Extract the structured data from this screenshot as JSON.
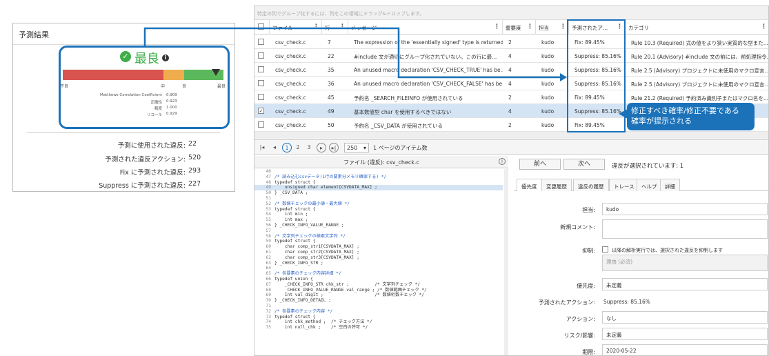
{
  "result_panel": {
    "title": "予測結果",
    "rating": "最良",
    "bar_labels": {
      "bad": "不良",
      "mid": "中",
      "good": "良",
      "best": "最良"
    },
    "metrics": [
      {
        "label": "Matthews Correlation Coefficient",
        "value": "0.909"
      },
      {
        "label": "正確性",
        "value": "0.923"
      },
      {
        "label": "精度",
        "value": "1.000"
      },
      {
        "label": "リコール",
        "value": "0.929"
      }
    ],
    "stats": [
      {
        "label": "予測に使用された違反:",
        "value": "22"
      },
      {
        "label": "予測された違反アクション:",
        "value": "520"
      },
      {
        "label": "Fix に予測された違反:",
        "value": "293"
      },
      {
        "label": "Suppress に予測された違反:",
        "value": "227"
      }
    ]
  },
  "grid": {
    "group_hint": "特定の列でグループ化するには、列をこの領域にドラッグ&ドロップします。",
    "columns": [
      "ファイル",
      "行",
      "メッセージ",
      "重要度",
      "担当",
      "予測されたア...",
      "カテゴリ"
    ],
    "rows": [
      {
        "file": "csv_check.c",
        "line": "7",
        "msg": "The expression of the 'essentially signed' type is returned fro...",
        "sev": "2",
        "owner": "kudo",
        "pred": "Fix: 89.45%",
        "cat": "Rule 10.3 (Required) 式の値をより狭い実質的な型また...",
        "checked": false
      },
      {
        "file": "csv_check.c",
        "line": "22",
        "msg": "#include 文が適切にグループ化されていない。この行に最...",
        "sev": "4",
        "owner": "kudo",
        "pred": "Suppress: 85.16%",
        "cat": "Rule 20.1 (Advisory) #include 文の前には、前処理指令...",
        "checked": false
      },
      {
        "file": "csv_check.c",
        "line": "35",
        "msg": "An unused macro declaration 'CSV_CHECK_TRUE' has be...",
        "sev": "4",
        "owner": "kudo",
        "pred": "Suppress: 85.16%",
        "cat": "Rule 2.5 (Advisory) プロジェクトに未使用のマクロ宣言...",
        "checked": false
      },
      {
        "file": "csv_check.c",
        "line": "36",
        "msg": "An unused macro declaration 'CSV_CHECK_FALSE' has be...",
        "sev": "4",
        "owner": "kudo",
        "pred": "Suppress: 85.16%",
        "cat": "Rule 2.5 (Advisory) プロジェクトに未使用のマクロ宣言...",
        "checked": false
      },
      {
        "file": "csv_check.c",
        "line": "45",
        "msg": "予約名 _SEARCH_FILEINFO が使用されている",
        "sev": "2",
        "owner": "kudo",
        "pred": "Fix: 89.45%",
        "cat": "Rule 21.2 (Required) 予約済み識別子またはマクロ名を...",
        "checked": false
      },
      {
        "file": "csv_check.c",
        "line": "49",
        "msg": "基本数値型 char を使用するべきではない",
        "sev": "4",
        "owner": "kudo",
        "pred": "Suppress: 85.16%",
        "cat": "",
        "checked": true
      },
      {
        "file": "csv_check.c",
        "line": "50",
        "msg": "予約名 _CSV_DATA が使用されている",
        "sev": "2",
        "owner": "kudo",
        "pred": "Fix: 89.45%",
        "cat": "",
        "checked": false
      }
    ]
  },
  "pager": {
    "pages": [
      "1",
      "2",
      "3"
    ],
    "page_size": "250",
    "page_size_label": "1 ページのアイテム数"
  },
  "code": {
    "title": "ファイル (違反): csv_check.c",
    "lines": [
      {
        "n": "46",
        "t": ""
      },
      {
        "n": "47",
        "t": "/* 読み込むcsvデータ(1行の要素分メモリ確保する) */"
      },
      {
        "n": "48",
        "t": "typedef struct {"
      },
      {
        "n": "49",
        "t": "    unsigned char element[CSVDATA_MAX] ;"
      },
      {
        "n": "50",
        "t": "} _CSV_DATA ;"
      },
      {
        "n": "51",
        "t": ""
      },
      {
        "n": "52",
        "t": "/* 数値チェックの最小値・最大値 */"
      },
      {
        "n": "53",
        "t": "typedef struct {"
      },
      {
        "n": "54",
        "t": "    int min ;"
      },
      {
        "n": "55",
        "t": "    int max ;"
      },
      {
        "n": "56",
        "t": "} _CHECK_INFO_VALUE_RANGE ;"
      },
      {
        "n": "57",
        "t": ""
      },
      {
        "n": "58",
        "t": "/* 文字列チェックの検索文字列 */"
      },
      {
        "n": "59",
        "t": "typedef struct {"
      },
      {
        "n": "60",
        "t": "    char comp_str1[CSVDATA_MAX] ;"
      },
      {
        "n": "61",
        "t": "    char comp_str2[CSVDATA_MAX] ;"
      },
      {
        "n": "62",
        "t": "    char comp_str3[CSVDATA_MAX] ;"
      },
      {
        "n": "63",
        "t": "} _CHECK_INFO_STR ;"
      },
      {
        "n": "64",
        "t": ""
      },
      {
        "n": "65",
        "t": "/* 各要素のチェック内容詳細 */"
      },
      {
        "n": "66",
        "t": "typedef union {"
      },
      {
        "n": "67",
        "t": "    _CHECK_INFO_STR chk_str ;          /* 文字列チェック */"
      },
      {
        "n": "68",
        "t": "    _CHECK_INFO_VALUE_RANGE val_range ; /* 数値範囲チェック */"
      },
      {
        "n": "69",
        "t": "    int val_digit ;                    /* 数値桁数チェック */"
      },
      {
        "n": "70",
        "t": "} _CHECK_INFO_DETAIL ;"
      },
      {
        "n": "71",
        "t": ""
      },
      {
        "n": "72",
        "t": "/* 各要素のチェック内容 */"
      },
      {
        "n": "73",
        "t": "typedef struct {"
      },
      {
        "n": "74",
        "t": "    int chk_method ;  /* チェック方法 */"
      },
      {
        "n": "75",
        "t": "    int null_chk ;    /* 空白の許可 */"
      }
    ]
  },
  "detail": {
    "prev": "前へ",
    "next": "次へ",
    "status": "違反が選択されています: 1",
    "tabs": [
      "優先度",
      "変更履歴",
      "違反の履歴",
      "トレース",
      "ヘルプ",
      "詳細"
    ],
    "fields": {
      "owner_label": "担当:",
      "owner_value": "kudo",
      "comment_label": "新規コメント:",
      "suppress_label": "抑制:",
      "suppress_text": "以降の解析実行では、選択された違反を抑制します",
      "reason_placeholder": "理由 (必須)",
      "priority_label": "優先度:",
      "priority_value": "未定義",
      "predicted_label": "予測されたアクション:",
      "predicted_value": "Suppress: 85.16%",
      "action_label": "アクション:",
      "action_value": "なし",
      "risk_label": "リスク/影響:",
      "risk_value": "未定義",
      "due_label": "期限:",
      "due_value": "2020-05-22"
    }
  },
  "callout": {
    "line1": "修正すべき確率/修正不要である",
    "line2": "確率が提示される"
  },
  "colors": {
    "accent": "#1b72b9",
    "good": "#3fae49",
    "bad": "#d9534f",
    "warn": "#f0ad4e"
  }
}
